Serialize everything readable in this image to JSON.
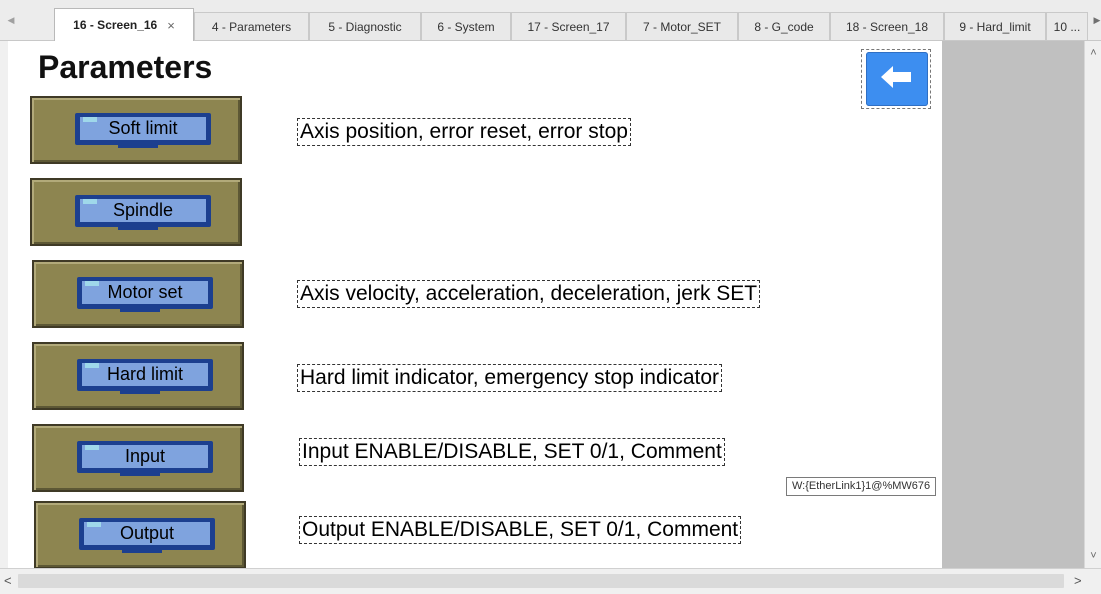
{
  "tabs": [
    {
      "label": "16 - Screen_16",
      "active": true,
      "closable": true
    },
    {
      "label": "4 - Parameters"
    },
    {
      "label": "5 - Diagnostic"
    },
    {
      "label": "6 - System"
    },
    {
      "label": "17 - Screen_17"
    },
    {
      "label": "7 - Motor_SET"
    },
    {
      "label": "8 - G_code"
    },
    {
      "label": "18 - Screen_18"
    },
    {
      "label": "9 - Hard_limit"
    },
    {
      "label": "10 ..."
    }
  ],
  "tab_close_glyph": "×",
  "page": {
    "title": "Parameters",
    "back_icon": "arrow-left-icon"
  },
  "buttons": [
    {
      "label": "Soft limit",
      "description": "Axis position, error reset, error stop"
    },
    {
      "label": "Spindle",
      "description": ""
    },
    {
      "label": "Motor set",
      "description": "Axis velocity, acceleration, deceleration, jerk SET"
    },
    {
      "label": "Hard limit",
      "description": "Hard limit indicator, emergency stop indicator"
    },
    {
      "label": "Input",
      "description": "Input ENABLE/DISABLE, SET 0/1, Comment"
    },
    {
      "label": "Output",
      "description": "Output ENABLE/DISABLE, SET 0/1, Comment"
    }
  ],
  "tooltip": "W:{EtherLink1}1@%MW676",
  "colors": {
    "button_body": "#8d8550",
    "screen_frame": "#1c3f8f",
    "screen_face": "#7fa3de",
    "back_button": "#3d8ef0",
    "side_panel": "#c0c0c0"
  }
}
